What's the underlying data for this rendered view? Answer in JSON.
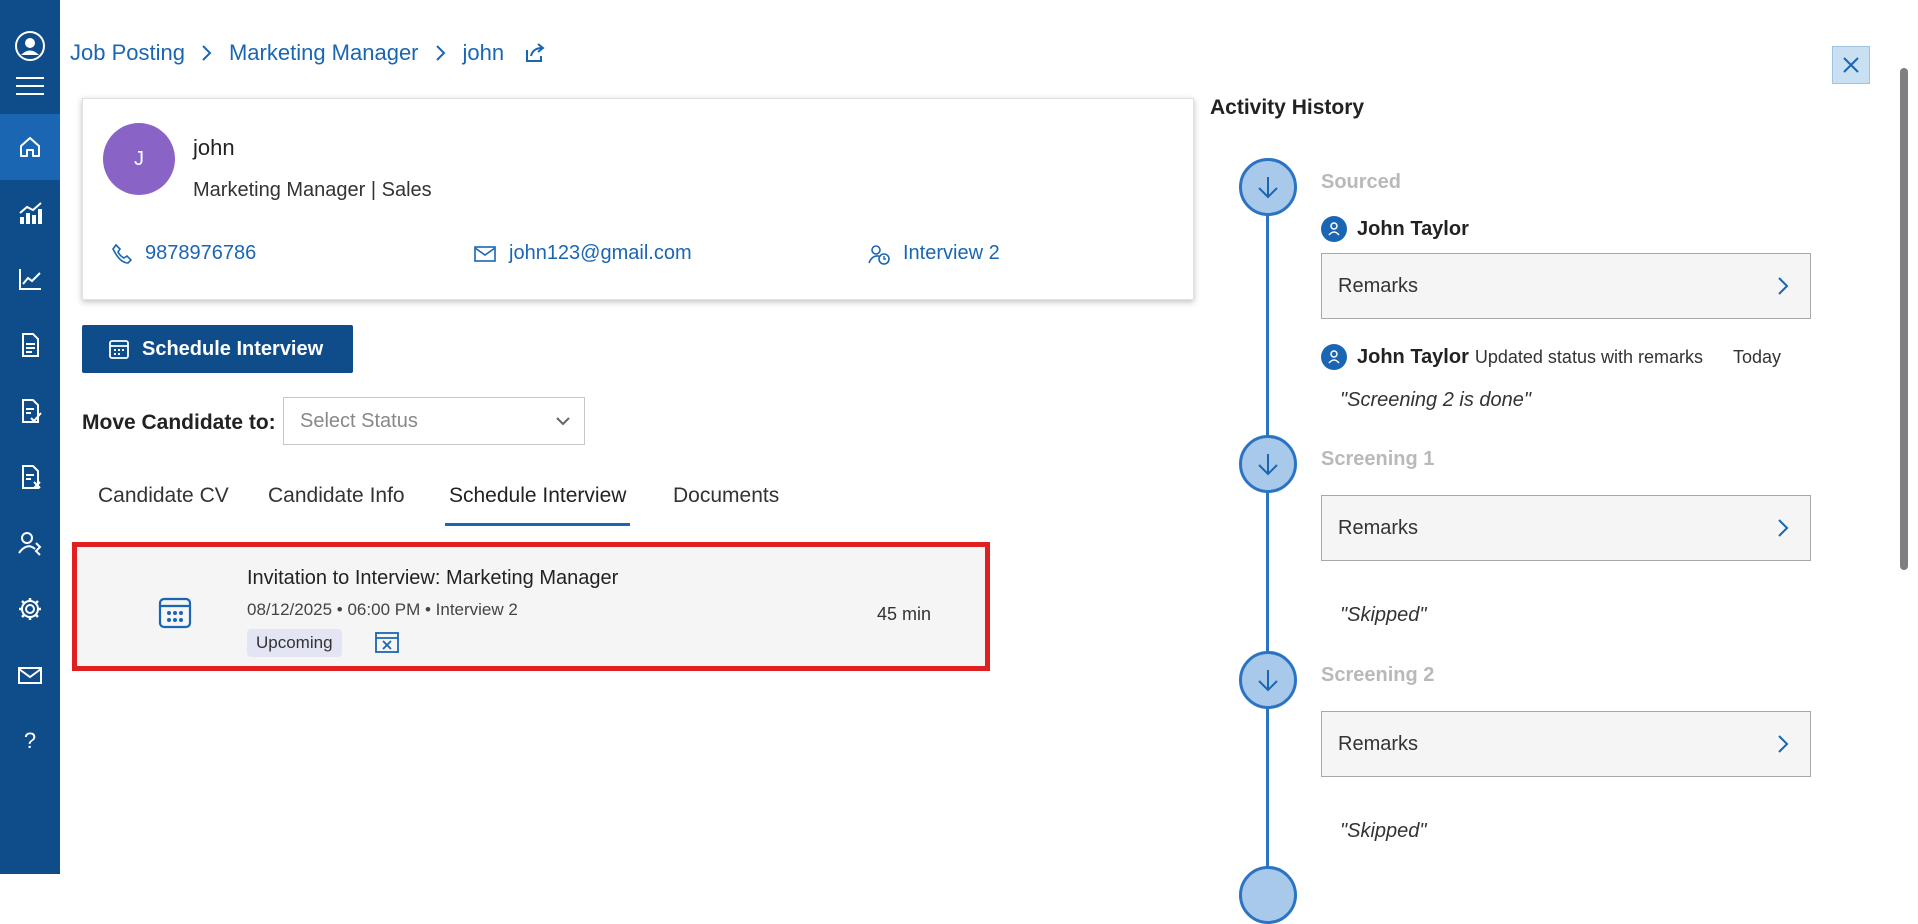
{
  "breadcrumb": {
    "items": [
      "Job Posting",
      "Marketing Manager",
      "john"
    ]
  },
  "candidate": {
    "initial": "J",
    "name": "john",
    "role": "Marketing Manager | Sales",
    "phone": "9878976786",
    "email": "john123@gmail.com",
    "stage": "Interview 2"
  },
  "actions": {
    "schedule_label": "Schedule Interview",
    "move_label": "Move Candidate to:",
    "status_placeholder": "Select Status"
  },
  "tabs": [
    {
      "label": "Candidate CV",
      "active": false
    },
    {
      "label": "Candidate Info",
      "active": false
    },
    {
      "label": "Schedule Interview",
      "active": true
    },
    {
      "label": "Documents",
      "active": false
    }
  ],
  "interview": {
    "title": "Invitation to Interview: Marketing Manager",
    "meta": "08/12/2025 • 06:00 PM • Interview 2",
    "badge": "Upcoming",
    "duration": "45 min"
  },
  "activity": {
    "title": "Activity History",
    "stages": [
      {
        "name": "Sourced",
        "remarks_label": "Remarks",
        "person": "John Taylor"
      },
      {
        "name": "Screening 1",
        "remarks_label": "Remarks",
        "quote": "\"Skipped\""
      },
      {
        "name": "Screening 2",
        "remarks_label": "Remarks",
        "quote": "\"Skipped\""
      }
    ],
    "update": {
      "person": "John Taylor",
      "text": "Updated status with remarks",
      "when": "Today",
      "quote": "\"Screening 2 is done\""
    }
  },
  "colors": {
    "sidebar": "#0f4c8a",
    "accent": "#1a66b3",
    "highlight_border": "#e02020",
    "avatar": "#8a63c7"
  },
  "icons": {
    "sidebar": [
      "profile-icon",
      "menu-icon",
      "home-icon",
      "analytics-icon",
      "chart-icon",
      "document-icon",
      "document-check-icon",
      "document-x-icon",
      "user-settings-icon",
      "gear-icon",
      "mail-icon",
      "help-icon"
    ]
  }
}
